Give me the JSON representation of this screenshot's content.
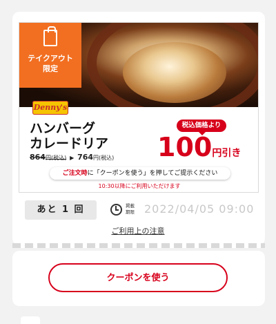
{
  "coupon": {
    "badge_line1": "テイクアウト",
    "badge_line2": "限定",
    "badge_icon": "shopping-bag-icon",
    "brand_logo_text": "Denny's",
    "product_name_line1": "ハンバーグ",
    "product_name_line2": "カレードリア",
    "price_old": "864",
    "price_old_unit": "円(税込)",
    "price_arrow": "▶",
    "price_new": "764",
    "price_new_unit": "円(税込)",
    "discount_tag": "税込価格より",
    "discount_amount": "100",
    "discount_unit": "円引き",
    "notice_prefix": "ご注文時",
    "notice_rest": "に「クーポンを使う」を押してご提示ください",
    "time_note": "10:30以降にご利用いただけます"
  },
  "status": {
    "remaining": "あと 1 回",
    "expiry_label": "掲載期限",
    "expiry_date": "2022/04/05 09:00",
    "terms_link": "ご利用上の注意"
  },
  "actions": {
    "use_coupon": "クーポンを使う"
  },
  "colors": {
    "accent_red": "#d7001b",
    "badge_orange": "#f26f21",
    "logo_yellow": "#f6c400"
  }
}
